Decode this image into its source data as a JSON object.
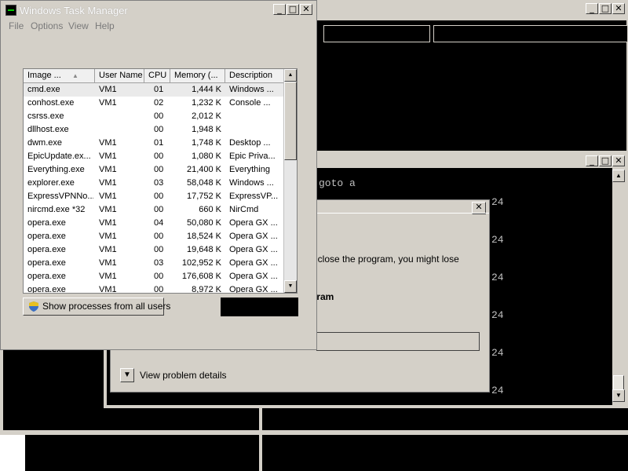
{
  "task_manager": {
    "title": "Windows Task Manager",
    "menu": [
      "File",
      "Options",
      "View",
      "Help"
    ],
    "columns": [
      "Image ...",
      "User Name",
      "CPU",
      "Memory (...",
      "Description"
    ],
    "rows": [
      {
        "image": "cmd.exe",
        "user": "VM1",
        "cpu": "01",
        "memory": "1,444 K",
        "description": "Windows ..."
      },
      {
        "image": "conhost.exe",
        "user": "VM1",
        "cpu": "02",
        "memory": "1,232 K",
        "description": "Console ..."
      },
      {
        "image": "csrss.exe",
        "user": "",
        "cpu": "00",
        "memory": "2,012 K",
        "description": ""
      },
      {
        "image": "dllhost.exe",
        "user": "",
        "cpu": "00",
        "memory": "1,948 K",
        "description": ""
      },
      {
        "image": "dwm.exe",
        "user": "VM1",
        "cpu": "01",
        "memory": "1,748 K",
        "description": "Desktop ..."
      },
      {
        "image": "EpicUpdate.ex...",
        "user": "VM1",
        "cpu": "00",
        "memory": "1,080 K",
        "description": "Epic Priva..."
      },
      {
        "image": "Everything.exe",
        "user": "VM1",
        "cpu": "00",
        "memory": "21,400 K",
        "description": "Everything"
      },
      {
        "image": "explorer.exe",
        "user": "VM1",
        "cpu": "03",
        "memory": "58,048 K",
        "description": "Windows ..."
      },
      {
        "image": "ExpressVPNNo...",
        "user": "VM1",
        "cpu": "00",
        "memory": "17,752 K",
        "description": "ExpressVP..."
      },
      {
        "image": "nircmd.exe *32",
        "user": "VM1",
        "cpu": "00",
        "memory": "660 K",
        "description": "NirCmd"
      },
      {
        "image": "opera.exe",
        "user": "VM1",
        "cpu": "04",
        "memory": "50,080 K",
        "description": "Opera GX ..."
      },
      {
        "image": "opera.exe",
        "user": "VM1",
        "cpu": "00",
        "memory": "18,524 K",
        "description": "Opera GX ..."
      },
      {
        "image": "opera.exe",
        "user": "VM1",
        "cpu": "00",
        "memory": "19,648 K",
        "description": "Opera GX ..."
      },
      {
        "image": "opera.exe",
        "user": "VM1",
        "cpu": "03",
        "memory": "102,952 K",
        "description": "Opera GX ..."
      },
      {
        "image": "opera.exe",
        "user": "VM1",
        "cpu": "00",
        "memory": "176,608 K",
        "description": "Opera GX ..."
      },
      {
        "image": "opera.exe",
        "user": "VM1",
        "cpu": "00",
        "memory": "8,972 K",
        "description": "Opera GX ..."
      }
    ],
    "show_all_button": "Show processes from all users"
  },
  "dialog": {
    "message": "rt or close the program, you might lose",
    "bold_text": "gram",
    "view_details": "View problem details",
    "close_glyph": "✕"
  },
  "console": {
    "goto_line": "goto a",
    "numbers": [
      "24",
      "24",
      "24",
      "24",
      "24",
      "24",
      "24"
    ]
  }
}
